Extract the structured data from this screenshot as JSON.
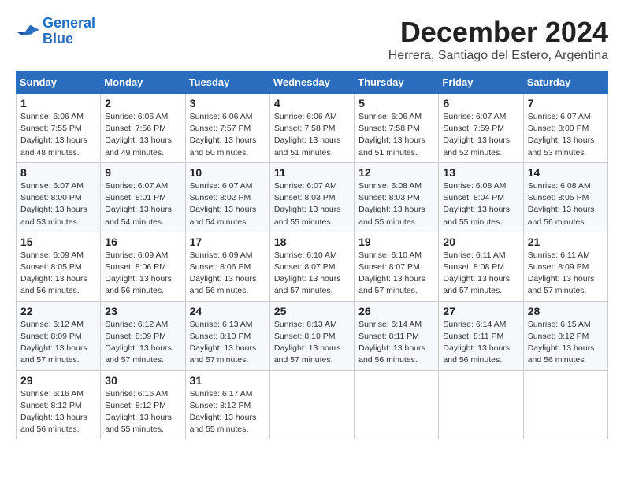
{
  "logo": {
    "line1": "General",
    "line2": "Blue"
  },
  "title": "December 2024",
  "location": "Herrera, Santiago del Estero, Argentina",
  "weekdays": [
    "Sunday",
    "Monday",
    "Tuesday",
    "Wednesday",
    "Thursday",
    "Friday",
    "Saturday"
  ],
  "weeks": [
    [
      {
        "day": "1",
        "info": "Sunrise: 6:06 AM\nSunset: 7:55 PM\nDaylight: 13 hours\nand 48 minutes."
      },
      {
        "day": "2",
        "info": "Sunrise: 6:06 AM\nSunset: 7:56 PM\nDaylight: 13 hours\nand 49 minutes."
      },
      {
        "day": "3",
        "info": "Sunrise: 6:06 AM\nSunset: 7:57 PM\nDaylight: 13 hours\nand 50 minutes."
      },
      {
        "day": "4",
        "info": "Sunrise: 6:06 AM\nSunset: 7:58 PM\nDaylight: 13 hours\nand 51 minutes."
      },
      {
        "day": "5",
        "info": "Sunrise: 6:06 AM\nSunset: 7:58 PM\nDaylight: 13 hours\nand 51 minutes."
      },
      {
        "day": "6",
        "info": "Sunrise: 6:07 AM\nSunset: 7:59 PM\nDaylight: 13 hours\nand 52 minutes."
      },
      {
        "day": "7",
        "info": "Sunrise: 6:07 AM\nSunset: 8:00 PM\nDaylight: 13 hours\nand 53 minutes."
      }
    ],
    [
      {
        "day": "8",
        "info": "Sunrise: 6:07 AM\nSunset: 8:00 PM\nDaylight: 13 hours\nand 53 minutes."
      },
      {
        "day": "9",
        "info": "Sunrise: 6:07 AM\nSunset: 8:01 PM\nDaylight: 13 hours\nand 54 minutes."
      },
      {
        "day": "10",
        "info": "Sunrise: 6:07 AM\nSunset: 8:02 PM\nDaylight: 13 hours\nand 54 minutes."
      },
      {
        "day": "11",
        "info": "Sunrise: 6:07 AM\nSunset: 8:03 PM\nDaylight: 13 hours\nand 55 minutes."
      },
      {
        "day": "12",
        "info": "Sunrise: 6:08 AM\nSunset: 8:03 PM\nDaylight: 13 hours\nand 55 minutes."
      },
      {
        "day": "13",
        "info": "Sunrise: 6:08 AM\nSunset: 8:04 PM\nDaylight: 13 hours\nand 55 minutes."
      },
      {
        "day": "14",
        "info": "Sunrise: 6:08 AM\nSunset: 8:05 PM\nDaylight: 13 hours\nand 56 minutes."
      }
    ],
    [
      {
        "day": "15",
        "info": "Sunrise: 6:09 AM\nSunset: 8:05 PM\nDaylight: 13 hours\nand 56 minutes."
      },
      {
        "day": "16",
        "info": "Sunrise: 6:09 AM\nSunset: 8:06 PM\nDaylight: 13 hours\nand 56 minutes."
      },
      {
        "day": "17",
        "info": "Sunrise: 6:09 AM\nSunset: 8:06 PM\nDaylight: 13 hours\nand 56 minutes."
      },
      {
        "day": "18",
        "info": "Sunrise: 6:10 AM\nSunset: 8:07 PM\nDaylight: 13 hours\nand 57 minutes."
      },
      {
        "day": "19",
        "info": "Sunrise: 6:10 AM\nSunset: 8:07 PM\nDaylight: 13 hours\nand 57 minutes."
      },
      {
        "day": "20",
        "info": "Sunrise: 6:11 AM\nSunset: 8:08 PM\nDaylight: 13 hours\nand 57 minutes."
      },
      {
        "day": "21",
        "info": "Sunrise: 6:11 AM\nSunset: 8:09 PM\nDaylight: 13 hours\nand 57 minutes."
      }
    ],
    [
      {
        "day": "22",
        "info": "Sunrise: 6:12 AM\nSunset: 8:09 PM\nDaylight: 13 hours\nand 57 minutes."
      },
      {
        "day": "23",
        "info": "Sunrise: 6:12 AM\nSunset: 8:09 PM\nDaylight: 13 hours\nand 57 minutes."
      },
      {
        "day": "24",
        "info": "Sunrise: 6:13 AM\nSunset: 8:10 PM\nDaylight: 13 hours\nand 57 minutes."
      },
      {
        "day": "25",
        "info": "Sunrise: 6:13 AM\nSunset: 8:10 PM\nDaylight: 13 hours\nand 57 minutes."
      },
      {
        "day": "26",
        "info": "Sunrise: 6:14 AM\nSunset: 8:11 PM\nDaylight: 13 hours\nand 56 minutes."
      },
      {
        "day": "27",
        "info": "Sunrise: 6:14 AM\nSunset: 8:11 PM\nDaylight: 13 hours\nand 56 minutes."
      },
      {
        "day": "28",
        "info": "Sunrise: 6:15 AM\nSunset: 8:12 PM\nDaylight: 13 hours\nand 56 minutes."
      }
    ],
    [
      {
        "day": "29",
        "info": "Sunrise: 6:16 AM\nSunset: 8:12 PM\nDaylight: 13 hours\nand 56 minutes."
      },
      {
        "day": "30",
        "info": "Sunrise: 6:16 AM\nSunset: 8:12 PM\nDaylight: 13 hours\nand 55 minutes."
      },
      {
        "day": "31",
        "info": "Sunrise: 6:17 AM\nSunset: 8:12 PM\nDaylight: 13 hours\nand 55 minutes."
      },
      null,
      null,
      null,
      null
    ]
  ]
}
